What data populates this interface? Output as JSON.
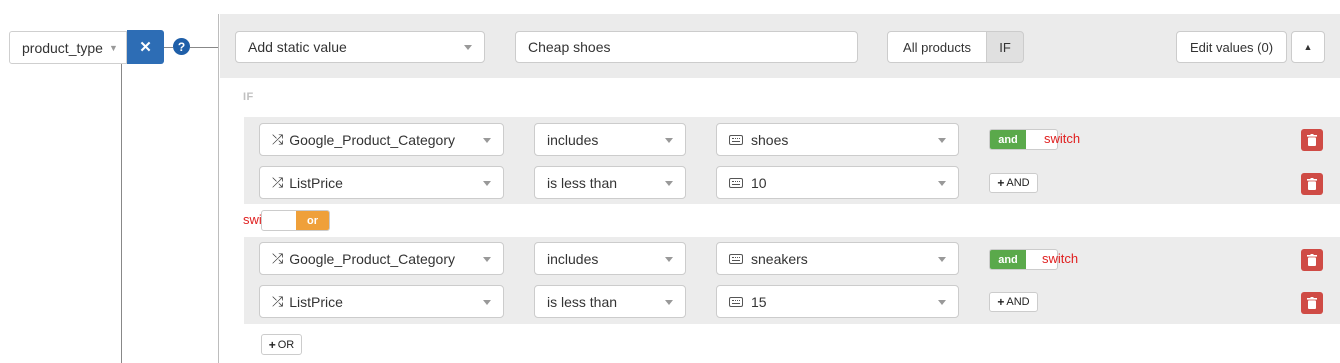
{
  "attribute": {
    "label": "product_type"
  },
  "header": {
    "mode_select": "Add static value",
    "value_input": "Cheap shoes",
    "scope_all_label": "All products",
    "scope_if_label": "IF",
    "edit_values_label": "Edit values (0)"
  },
  "conditions_title": "IF",
  "groups": [
    {
      "rows": [
        {
          "field": "Google_Product_Category",
          "operator": "includes",
          "value": "shoes",
          "action": "toggle"
        },
        {
          "field": "ListPrice",
          "operator": "is less than",
          "value": "10",
          "action": "add"
        }
      ],
      "toggle_label": "and",
      "switch_note": "switch",
      "add_label": "AND"
    },
    {
      "rows": [
        {
          "field": "Google_Product_Category",
          "operator": "includes",
          "value": "sneakers",
          "action": "toggle"
        },
        {
          "field": "ListPrice",
          "operator": "is less than",
          "value": "15",
          "action": "add"
        }
      ],
      "toggle_label": "and",
      "switch_note": "switch",
      "add_label": "AND"
    }
  ],
  "group_connector": {
    "switch_note": "switch",
    "toggle_label": "or"
  },
  "add_or_label": "OR",
  "colors": {
    "primary": "#2d6db5",
    "and": "#5aa94b",
    "or": "#efa03a",
    "danger": "#cf4b45",
    "note": "#e02020"
  },
  "icons": [
    "caret-down-icon",
    "close-icon",
    "help-icon",
    "shuffle-icon",
    "keyboard-icon",
    "trash-icon",
    "plus-icon",
    "chevron-up-icon"
  ]
}
